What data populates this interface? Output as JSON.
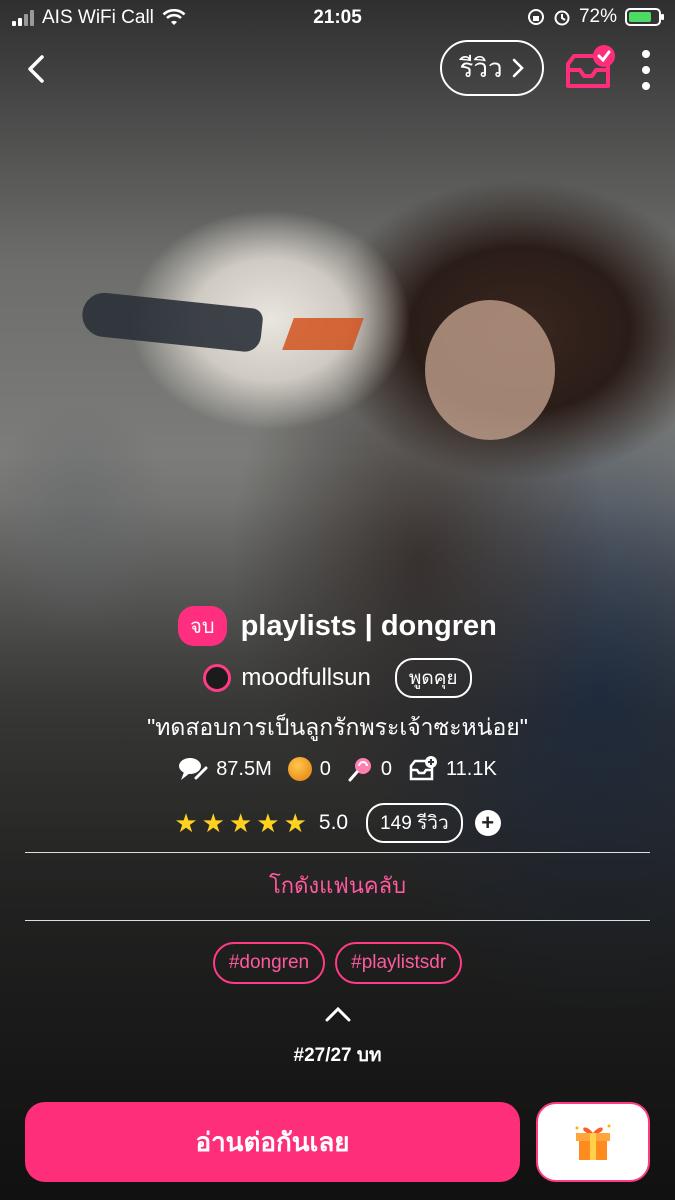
{
  "status_bar": {
    "carrier": "AIS WiFi Call",
    "time": "21:05",
    "battery": "72%",
    "battery_level": 0.72
  },
  "topbar": {
    "review_label": "รีวิว"
  },
  "novel": {
    "status_badge": "จบ",
    "title": "playlists | dongren",
    "author": "moodfullsun",
    "chat_label": "พูดคุย",
    "tagline": "\"ทดสอบการเป็นลูกรักพระเจ้าซะหน่อย\""
  },
  "stats": {
    "views": "87.5M",
    "coins": "0",
    "candies": "0",
    "library_adds": "11.1K"
  },
  "rating": {
    "stars": 5,
    "score": "5.0",
    "reviews": "149 รีวิว"
  },
  "fanclub_label": "โกดังแฟนคลับ",
  "tags": [
    "#dongren",
    "#playlistsdr"
  ],
  "chapters": "#27/27 บท",
  "read_button": "อ่านต่อกันเลย",
  "colors": {
    "accent": "#ff2e7a",
    "star": "#ffd21f"
  }
}
